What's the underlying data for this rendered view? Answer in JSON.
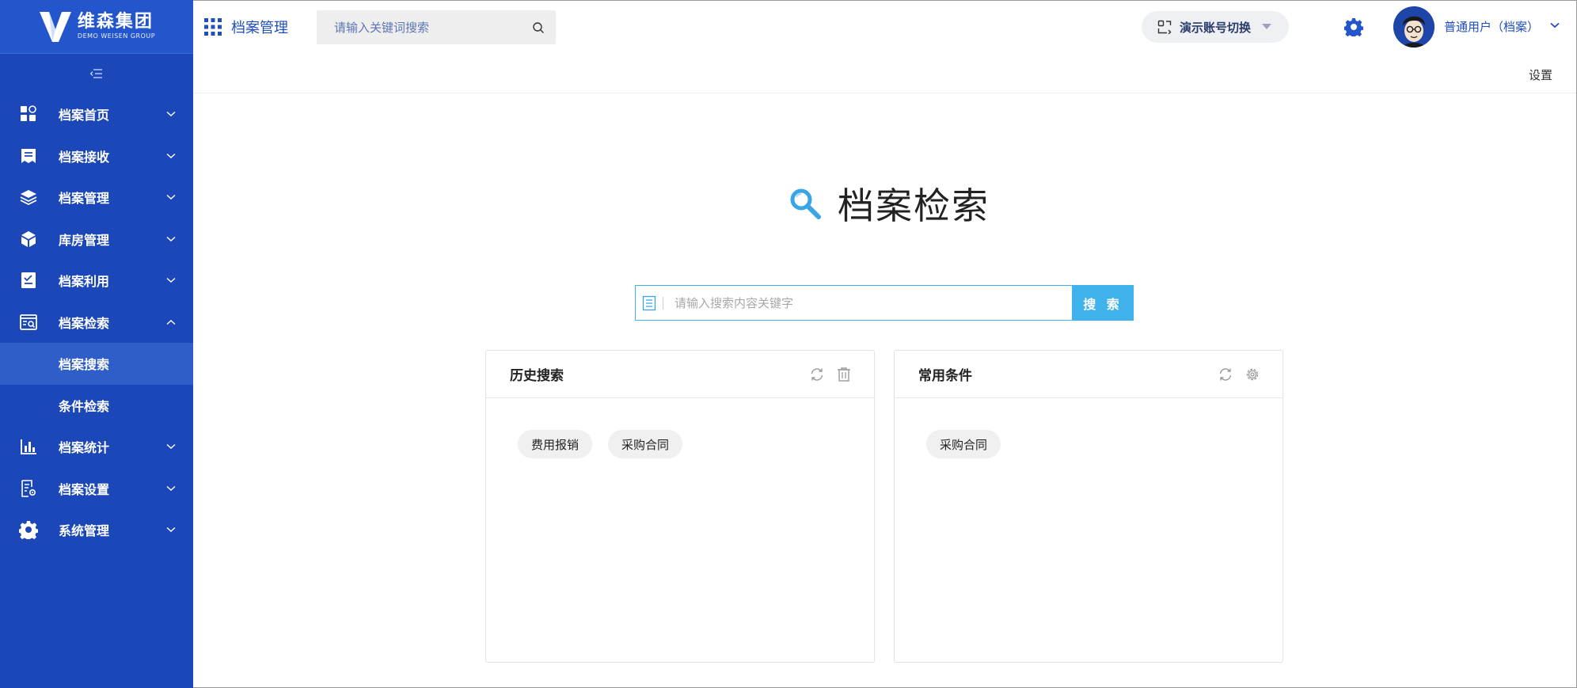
{
  "brand": {
    "name_cn": "维森集团",
    "name_en": "DEMO WEISEN GROUP"
  },
  "sidebar": {
    "items": [
      {
        "label": "档案首页",
        "icon": "dashboard-icon"
      },
      {
        "label": "档案接收",
        "icon": "receive-icon"
      },
      {
        "label": "档案管理",
        "icon": "layers-icon"
      },
      {
        "label": "库房管理",
        "icon": "box-icon"
      },
      {
        "label": "档案利用",
        "icon": "checklist-icon"
      },
      {
        "label": "档案检索",
        "icon": "doc-search-icon",
        "expanded": true,
        "children": [
          {
            "label": "档案搜索",
            "active": true
          },
          {
            "label": "条件检索"
          }
        ]
      },
      {
        "label": "档案统计",
        "icon": "bar-chart-icon"
      },
      {
        "label": "档案设置",
        "icon": "doc-settings-icon"
      },
      {
        "label": "系统管理",
        "icon": "gear-icon"
      }
    ]
  },
  "header": {
    "app_name": "档案管理",
    "search_placeholder": "请输入关键词搜索",
    "account_switch": "演示账号切换",
    "user_name": "普通用户（档案）"
  },
  "subheader": {
    "settings": "设置"
  },
  "main": {
    "title": "档案检索",
    "search_placeholder": "请输入搜索内容关键字",
    "search_button": "搜 索",
    "history": {
      "title": "历史搜索",
      "tags": [
        "费用报销",
        "采购合同"
      ]
    },
    "common": {
      "title": "常用条件",
      "tags": [
        "采购合同"
      ]
    }
  },
  "colors": {
    "sidebar": "#1b47b8",
    "accent": "#3fb2ec",
    "brand_blue": "#1f4fbf"
  }
}
